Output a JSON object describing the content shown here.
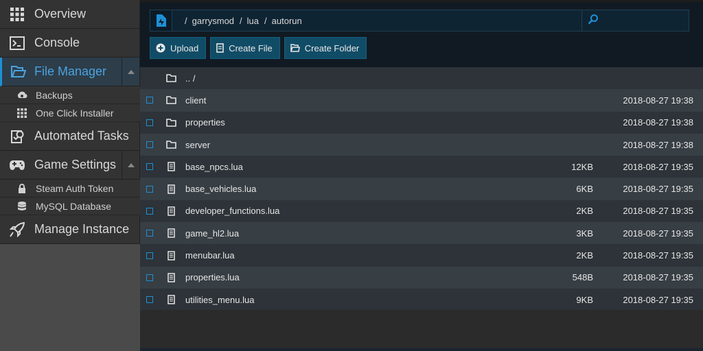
{
  "sidebar": {
    "items": [
      {
        "label": "Overview",
        "icon": "grid-icon"
      },
      {
        "label": "Console",
        "icon": "terminal-icon"
      },
      {
        "label": "File Manager",
        "icon": "folder-open-icon"
      },
      {
        "label": "Automated Tasks",
        "icon": "tasks-icon"
      },
      {
        "label": "Game Settings",
        "icon": "gamepad-icon"
      },
      {
        "label": "Manage Instance",
        "icon": "rocket-icon"
      }
    ],
    "file_manager_sub": [
      {
        "label": "Backups",
        "icon": "backup-icon"
      },
      {
        "label": "One Click Installer",
        "icon": "grid-icon"
      }
    ],
    "game_settings_sub": [
      {
        "label": "Steam Auth Token",
        "icon": "lock-icon"
      },
      {
        "label": "MySQL Database",
        "icon": "database-icon"
      }
    ]
  },
  "path": {
    "segments": [
      "garrysmod",
      "lua",
      "autorun"
    ],
    "separator": "/"
  },
  "toolbar": {
    "upload_label": "Upload",
    "create_file_label": "Create File",
    "create_folder_label": "Create Folder"
  },
  "files": {
    "parent_label": ".. /",
    "rows": [
      {
        "name": "client",
        "type": "folder",
        "size": "",
        "date": "2018-08-27 19:38"
      },
      {
        "name": "properties",
        "type": "folder",
        "size": "",
        "date": "2018-08-27 19:38"
      },
      {
        "name": "server",
        "type": "folder",
        "size": "",
        "date": "2018-08-27 19:38"
      },
      {
        "name": "base_npcs.lua",
        "type": "file",
        "size": "12KB",
        "date": "2018-08-27 19:35"
      },
      {
        "name": "base_vehicles.lua",
        "type": "file",
        "size": "6KB",
        "date": "2018-08-27 19:35"
      },
      {
        "name": "developer_functions.lua",
        "type": "file",
        "size": "2KB",
        "date": "2018-08-27 19:35"
      },
      {
        "name": "game_hl2.lua",
        "type": "file",
        "size": "3KB",
        "date": "2018-08-27 19:35"
      },
      {
        "name": "menubar.lua",
        "type": "file",
        "size": "2KB",
        "date": "2018-08-27 19:35"
      },
      {
        "name": "properties.lua",
        "type": "file",
        "size": "548B",
        "date": "2018-08-27 19:35"
      },
      {
        "name": "utilities_menu.lua",
        "type": "file",
        "size": "9KB",
        "date": "2018-08-27 19:35"
      }
    ]
  },
  "colors": {
    "accent": "#1e90d6",
    "sidebar_bg": "#333333",
    "topbar_bg": "#111a22",
    "button_bg": "#114c66"
  }
}
